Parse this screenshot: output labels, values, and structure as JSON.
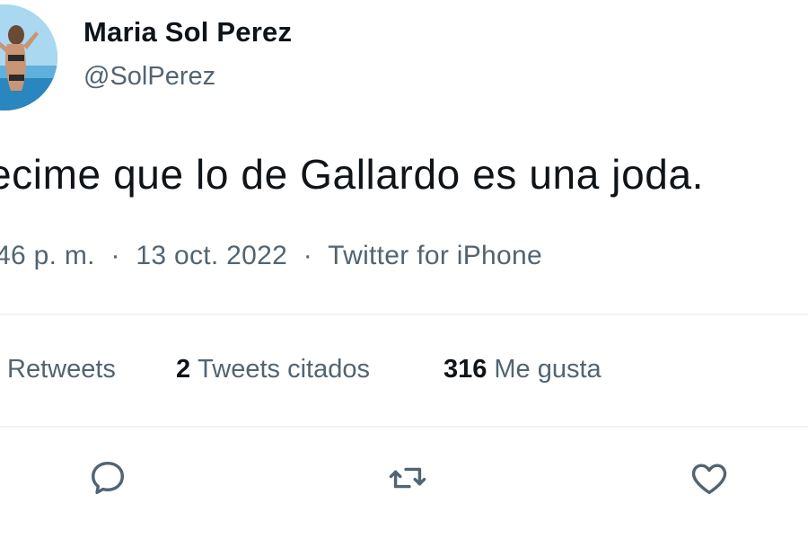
{
  "user": {
    "display_name": "Maria Sol Perez",
    "handle": "@SolPerez",
    "avatar_icon": "profile-photo"
  },
  "tweet": {
    "text": "ecime que lo de Gallardo es una joda."
  },
  "meta": {
    "time": "46 p. m.",
    "separator": "·",
    "date": "13 oct. 2022",
    "source": "Twitter for iPhone"
  },
  "stats": {
    "retweets_label": "Retweets",
    "retweets_partial": "",
    "quotes_count": "2",
    "quotes_label": "Tweets citados",
    "likes_count": "316",
    "likes_label": "Me gusta"
  },
  "actions": {
    "reply_icon": "reply-icon",
    "retweet_icon": "retweet-icon",
    "like_icon": "heart-icon"
  },
  "colors": {
    "primary_text": "#0f1419",
    "secondary_text": "#536471",
    "divider": "#eff3f4"
  }
}
